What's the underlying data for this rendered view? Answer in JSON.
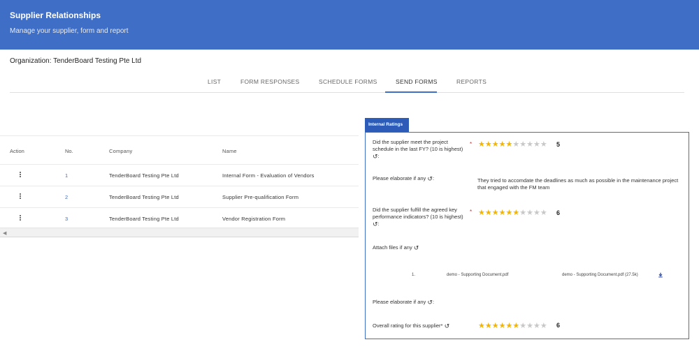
{
  "header": {
    "title": "Supplier Relationships",
    "subtitle": "Manage your supplier, form and report"
  },
  "organization": "Organization: TenderBoard Testing Pte Ltd",
  "tabs": [
    {
      "label": "LIST",
      "active": false
    },
    {
      "label": "FORM RESPONSES",
      "active": false
    },
    {
      "label": "SCHEDULE FORMS",
      "active": false
    },
    {
      "label": "SEND FORMS",
      "active": true
    },
    {
      "label": "REPORTS",
      "active": false
    }
  ],
  "grid": {
    "columns": [
      "Action",
      "No.",
      "Company",
      "Name"
    ],
    "rows": [
      {
        "no": "1",
        "company": "TenderBoard Testing Pte Ltd",
        "name": "Internal Form - Evaluation of Vendors"
      },
      {
        "no": "2",
        "company": "TenderBoard Testing Pte Ltd",
        "name": "Supplier Pre-qualification Form"
      },
      {
        "no": "3",
        "company": "TenderBoard Testing Pte Ltd",
        "name": "Vendor Registration Form"
      }
    ]
  },
  "panel": {
    "tab_label": "Internal Ratings",
    "q1": {
      "line1": "Did the supplier meet the project",
      "line2": "schedule in the last FY? (10 is highest)",
      "rating": 5,
      "max": 10,
      "value_label": "5"
    },
    "q2": {
      "label": "Please elaborate if any",
      "answer": "They tried to accomdate the deadlines as much as possible in the maintenance project that engaged with the FM team"
    },
    "q3": {
      "line1": "Did the supplier fulfill the agreed key",
      "line2": "performance indicators? (10 is highest)",
      "rating": 6,
      "max": 10,
      "value_label": "6"
    },
    "q4": {
      "label": "Attach files if any"
    },
    "file": {
      "index": "1.",
      "name": "demo - Supporting Document.pdf",
      "download": "demo - Supporting Document.pdf (27.5k)"
    },
    "q5": {
      "label": "Please elaborate if any"
    },
    "q6": {
      "label": "Overall rating for this supplier*",
      "rating": 6,
      "max": 10,
      "value_label": "6"
    }
  },
  "colors": {
    "header": "#3f6ec6",
    "star": "#f5b400",
    "star_empty": "#c8c8c8"
  },
  "icons": {
    "history": "history-icon",
    "download": "download-icon",
    "more": "more-vert-icon"
  }
}
